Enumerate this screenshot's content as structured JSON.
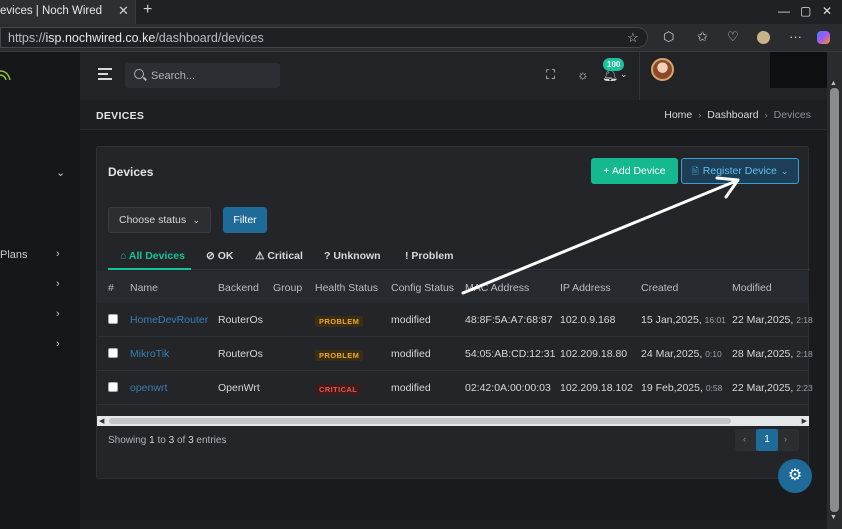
{
  "browser": {
    "tab_title": "evices | Noch Wired",
    "close_glyph": "✕",
    "new_tab_glyph": "+",
    "url_scheme": "https://",
    "url_host": "isp.nochwired.co.ke",
    "url_path": "/dashboard/devices",
    "window_controls": [
      "—",
      "▢",
      "✕"
    ]
  },
  "sidebar": {
    "items": [
      {
        "label": "",
        "chevron": "⌄"
      },
      {
        "label": "Plans",
        "chevron": "›"
      },
      {
        "label": "",
        "chevron": "›"
      },
      {
        "label": "",
        "chevron": "›"
      },
      {
        "label": "",
        "chevron": "›"
      }
    ]
  },
  "header": {
    "search_placeholder": "Search...",
    "notification_count": "100",
    "avatar_suffix": "⌄"
  },
  "page": {
    "title": "DEVICES",
    "breadcrumb": [
      "Home",
      "Dashboard",
      "Devices"
    ],
    "breadcrumb_sep": "›"
  },
  "card": {
    "title": "Devices",
    "add_button": "+ Add Device",
    "register_button": "Register Device",
    "register_icon": "🗎",
    "register_chevron": "⌄",
    "status_select": "Choose status",
    "filter_button": "Filter"
  },
  "tabs": [
    {
      "label": "All Devices",
      "icon": "⌂"
    },
    {
      "label": "OK",
      "icon": "⊘"
    },
    {
      "label": "Critical",
      "icon": "⚠"
    },
    {
      "label": "Unknown",
      "icon": "?"
    },
    {
      "label": "Problem",
      "icon": "!"
    }
  ],
  "table": {
    "columns": [
      "#",
      "Name",
      "Backend",
      "Group",
      "Health Status",
      "Config Status",
      "MAC Address",
      "IP Address",
      "Created",
      "Modified"
    ],
    "rows": [
      {
        "name": "HomeDevRouter",
        "backend": "RouterOs",
        "group": "",
        "health": "PROBLEM",
        "health_type": "problem",
        "config": "modified",
        "mac": "48:8F:5A:A7:68:87",
        "ip": "102.0.9.168",
        "created_date": "15 Jan,2025,",
        "created_time": "16:01",
        "modified_date": "22 Mar,2025,",
        "modified_time": "2:18"
      },
      {
        "name": "MikroTik",
        "backend": "RouterOs",
        "group": "",
        "health": "PROBLEM",
        "health_type": "problem",
        "config": "modified",
        "mac": "54:05:AB:CD:12:31",
        "ip": "102.209.18.80",
        "created_date": "24 Mar,2025,",
        "created_time": "0:10",
        "modified_date": "28 Mar,2025,",
        "modified_time": "2:18"
      },
      {
        "name": "openwrt",
        "backend": "OpenWrt",
        "group": "",
        "health": "CRITICAL",
        "health_type": "critical",
        "config": "modified",
        "mac": "02:42:0A:00:00:03",
        "ip": "102.209.18.102",
        "created_date": "19 Feb,2025,",
        "created_time": "0:58",
        "modified_date": "22 Mar,2025,",
        "modified_time": "2:23"
      }
    ]
  },
  "footer": {
    "showing_prefix": "Showing",
    "from": "1",
    "to_word": "to",
    "to": "3",
    "of_word": "of",
    "total": "3",
    "entries_word": "entries",
    "current_page": "1",
    "prev": "‹",
    "next": "›"
  },
  "colors": {
    "accent_green": "#14b98f",
    "accent_blue": "#1e6a98",
    "problem": "#e8a82a",
    "critical": "#e8574f"
  }
}
